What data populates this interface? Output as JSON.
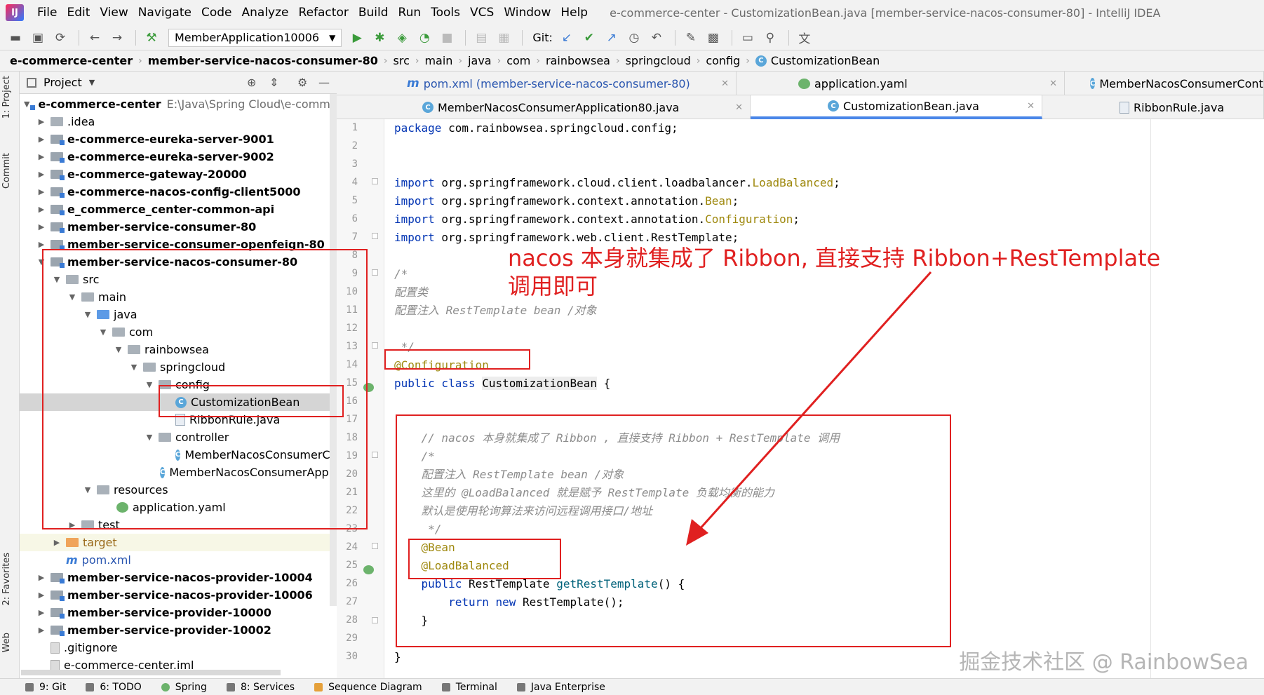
{
  "window_title": "e-commerce-center - CustomizationBean.java [member-service-nacos-consumer-80] - IntelliJ IDEA",
  "menu": [
    "File",
    "Edit",
    "View",
    "Navigate",
    "Code",
    "Analyze",
    "Refactor",
    "Build",
    "Run",
    "Tools",
    "VCS",
    "Window",
    "Help"
  ],
  "toolbar": {
    "run_config": "MemberApplication10006",
    "git_label": "Git:"
  },
  "breadcrumb": [
    "e-commerce-center",
    "member-service-nacos-consumer-80",
    "src",
    "main",
    "java",
    "com",
    "rainbowsea",
    "springcloud",
    "config",
    "CustomizationBean"
  ],
  "left_stripe": {
    "project": "1: Project",
    "commit": "Commit",
    "favorites": "2: Favorites",
    "web": "Web"
  },
  "project_panel": {
    "title": "Project"
  },
  "tree": [
    {
      "label": "e-commerce-center",
      "extra": "E:\\Java\\Spring Cloud\\e-commerce"
    },
    {
      "label": ".idea"
    },
    {
      "label": "e-commerce-eureka-server-9001"
    },
    {
      "label": "e-commerce-eureka-server-9002"
    },
    {
      "label": "e-commerce-gateway-20000"
    },
    {
      "label": "e-commerce-nacos-config-client5000"
    },
    {
      "label": "e_commerce_center-common-api"
    },
    {
      "label": "member-service-consumer-80"
    },
    {
      "label": "member-service-consumer-openfeign-80"
    },
    {
      "label": "member-service-nacos-consumer-80"
    },
    {
      "label": "src"
    },
    {
      "label": "main"
    },
    {
      "label": "java"
    },
    {
      "label": "com"
    },
    {
      "label": "rainbowsea"
    },
    {
      "label": "springcloud"
    },
    {
      "label": "config"
    },
    {
      "label": "CustomizationBean"
    },
    {
      "label": "RibbonRule.java"
    },
    {
      "label": "controller"
    },
    {
      "label": "MemberNacosConsumerCo"
    },
    {
      "label": "MemberNacosConsumerApplic"
    },
    {
      "label": "resources"
    },
    {
      "label": "application.yaml"
    },
    {
      "label": "test"
    },
    {
      "label": "target"
    },
    {
      "label": "pom.xml"
    },
    {
      "label": "member-service-nacos-provider-10004"
    },
    {
      "label": "member-service-nacos-provider-10006"
    },
    {
      "label": "member-service-provider-10000"
    },
    {
      "label": "member-service-provider-10002"
    },
    {
      "label": ".gitignore"
    },
    {
      "label": "e-commerce-center.iml"
    }
  ],
  "tabs_row1": [
    {
      "label": "pom.xml (member-service-nacos-consumer-80)"
    },
    {
      "label": "application.yaml"
    },
    {
      "label": "MemberNacosConsumerController.java"
    }
  ],
  "tabs_row2": [
    {
      "label": "MemberNacosConsumerApplication80.java"
    },
    {
      "label": "CustomizationBean.java"
    },
    {
      "label": "RibbonRule.java"
    }
  ],
  "line_numbers": [
    "1",
    "2",
    "3",
    "4",
    "5",
    "6",
    "7",
    "8",
    "9",
    "10",
    "11",
    "12",
    "13",
    "14",
    "15",
    "16",
    "17",
    "18",
    "19",
    "20",
    "21",
    "22",
    "23",
    "24",
    "25",
    "26",
    "27",
    "28",
    "29",
    "30"
  ],
  "code": {
    "l1_kw": "package",
    "l1_rest": " com.rainbowsea.springcloud.config;",
    "l4_kw": "import",
    "l4_rest": " org.springframework.cloud.client.loadbalancer.",
    "l4_an": "LoadBalanced",
    "l4_end": ";",
    "l5_kw": "import",
    "l5_rest": " org.springframework.context.annotation.",
    "l5_an": "Bean",
    "l5_end": ";",
    "l6_kw": "import",
    "l6_rest": " org.springframework.context.annotation.",
    "l6_an": "Configuration",
    "l6_end": ";",
    "l7_kw": "import",
    "l7_rest": " org.springframework.web.client.RestTemplate;",
    "l9": "/*",
    "l10": "配置类",
    "l11": "配置注入 RestTemplate bean /对象",
    "l13": " */",
    "l14": "@Configuration",
    "l15_kw": "public class",
    "l15_cls": "CustomizationBean",
    "l15_end": " {",
    "l18": "    // nacos 本身就集成了 Ribbon , 直接支持 Ribbon + RestTemplate 调用",
    "l19": "    /*",
    "l20": "    配置注入 RestTemplate bean /对象",
    "l21": "    这里的 @LoadBalanced 就是赋予 RestTemplate 负载均衡的能力",
    "l22": "    默认是使用轮询算法来访问远程调用接口/地址",
    "l23": "     */",
    "l24": "    @Bean",
    "l25": "    @LoadBalanced",
    "l26_kw": "    public",
    "l26_type": " RestTemplate ",
    "l26_fn": "getRestTemplate",
    "l26_end": "() {",
    "l27_kw": "        return new",
    "l27_end": " RestTemplate();",
    "l28": "    }",
    "l30": "}"
  },
  "annotation_text": "nacos  本身就集成了 Ribbon, 直接支持  Ribbon+RestTemplate 调用即可",
  "bottom_tools": [
    "9: Git",
    "6: TODO",
    "Spring",
    "8: Services",
    "Sequence Diagram",
    "Terminal",
    "Java Enterprise"
  ],
  "watermark": "掘金技术社区 @ RainbowSea"
}
